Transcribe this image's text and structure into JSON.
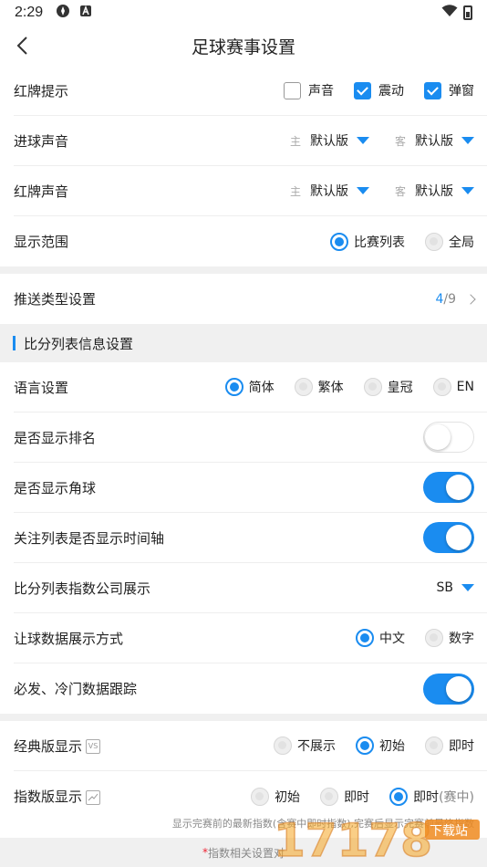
{
  "status_bar": {
    "time": "2:29"
  },
  "header": {
    "title": "足球赛事设置"
  },
  "red_card_alert": {
    "label": "红牌提示",
    "options": [
      {
        "label": "声音",
        "checked": false
      },
      {
        "label": "震动",
        "checked": true
      },
      {
        "label": "弹窗",
        "checked": true
      }
    ]
  },
  "goal_sound": {
    "label": "进球声音",
    "home_prefix": "主",
    "home_value": "默认版",
    "away_prefix": "客",
    "away_value": "默认版"
  },
  "red_card_sound": {
    "label": "红牌声音",
    "home_prefix": "主",
    "home_value": "默认版",
    "away_prefix": "客",
    "away_value": "默认版"
  },
  "display_range": {
    "label": "显示范围",
    "options": [
      {
        "label": "比赛列表",
        "selected": true
      },
      {
        "label": "全局",
        "selected": false
      }
    ]
  },
  "push_type": {
    "label": "推送类型设置",
    "count_selected": "4",
    "count_total": "/9"
  },
  "score_list_section": {
    "title": "比分列表信息设置"
  },
  "language": {
    "label": "语言设置",
    "options": [
      {
        "label": "简体",
        "selected": true
      },
      {
        "label": "繁体",
        "selected": false
      },
      {
        "label": "皇冠",
        "selected": false
      },
      {
        "label": "EN",
        "selected": false
      }
    ]
  },
  "show_rank": {
    "label": "是否显示排名",
    "on": false
  },
  "show_corner": {
    "label": "是否显示角球",
    "on": true
  },
  "show_timeline": {
    "label": "关注列表是否显示时间轴",
    "on": true
  },
  "index_company": {
    "label": "比分列表指数公司展示",
    "value": "SB"
  },
  "handicap_display": {
    "label": "让球数据展示方式",
    "options": [
      {
        "label": "中文",
        "selected": true
      },
      {
        "label": "数字",
        "selected": false
      }
    ]
  },
  "cold_tracking": {
    "label": "必发、冷门数据跟踪",
    "on": true
  },
  "classic_display": {
    "label": "经典版显示",
    "icon_text": "VS",
    "options": [
      {
        "label": "不展示",
        "selected": false
      },
      {
        "label": "初始",
        "selected": true
      },
      {
        "label": "即时",
        "selected": false
      }
    ]
  },
  "index_display": {
    "label": "指数版显示",
    "options": [
      {
        "label": "初始",
        "selected": false
      },
      {
        "label": "即时",
        "selected": false
      },
      {
        "label": "即时",
        "suffix": "(赛中)",
        "selected": true
      }
    ]
  },
  "index_note": "显示完赛前的最新指数(含赛中即时指数),完赛后显示完赛前最终指数",
  "footer_note": "指数相关设置对",
  "watermark": {
    "text": "17178",
    "sub": "下载站"
  },
  "colors": {
    "accent": "#1a8cf0",
    "divider": "#eeeeee",
    "section_bg": "#f0f0f0"
  }
}
